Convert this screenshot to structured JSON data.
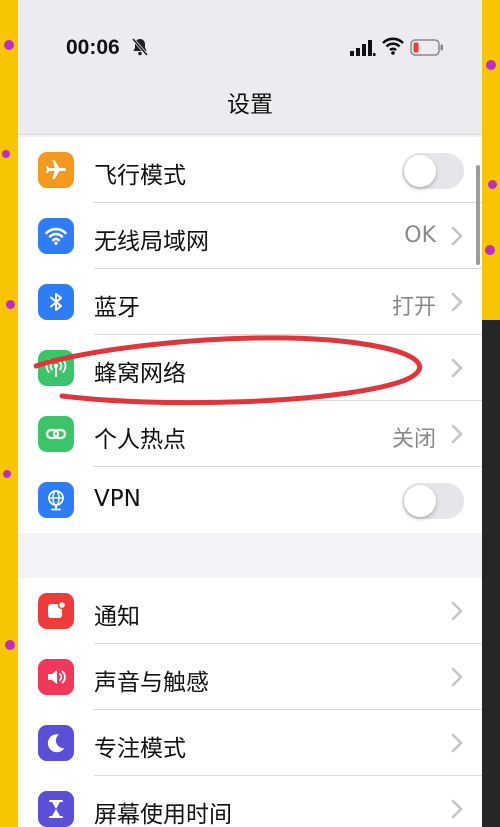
{
  "status_bar": {
    "time": "00:06",
    "icons": [
      "bell-slash-icon",
      "cellular-signal-icon",
      "wifi-icon",
      "battery-low-icon"
    ]
  },
  "nav": {
    "title": "设置"
  },
  "colors": {
    "airplane": "#f39a1e",
    "wifi": "#2f7df6",
    "bluetooth": "#2f7df6",
    "cellular": "#3cc46a",
    "hotspot": "#3cc46a",
    "vpn": "#2f7df6",
    "notifications": "#f03b3b",
    "sounds": "#f2385a",
    "focus": "#5a4fd8",
    "screen_time": "#5a4fd8",
    "annotation": "#e0363b"
  },
  "groups": [
    {
      "rows": [
        {
          "label": "飞行模式",
          "icon": "airplane-icon",
          "accessory": "toggle",
          "on": false
        },
        {
          "label": "无线局域网",
          "icon": "wifi-icon",
          "accessory": "chevron",
          "value": "OK"
        },
        {
          "label": "蓝牙",
          "icon": "bluetooth-icon",
          "accessory": "chevron",
          "value": "打开"
        },
        {
          "label": "蜂窝网络",
          "icon": "cellular-antenna-icon",
          "accessory": "chevron"
        },
        {
          "label": "个人热点",
          "icon": "hotspot-link-icon",
          "accessory": "chevron",
          "value": "关闭"
        },
        {
          "label": "VPN",
          "icon": "vpn-globe-icon",
          "accessory": "toggle",
          "on": false
        }
      ]
    },
    {
      "rows": [
        {
          "label": "通知",
          "icon": "notification-bell-icon",
          "accessory": "chevron"
        },
        {
          "label": "声音与触感",
          "icon": "speaker-icon",
          "accessory": "chevron"
        },
        {
          "label": "专注模式",
          "icon": "moon-icon",
          "accessory": "chevron"
        },
        {
          "label": "屏幕使用时间",
          "icon": "hourglass-icon",
          "accessory": "chevron"
        }
      ]
    }
  ]
}
